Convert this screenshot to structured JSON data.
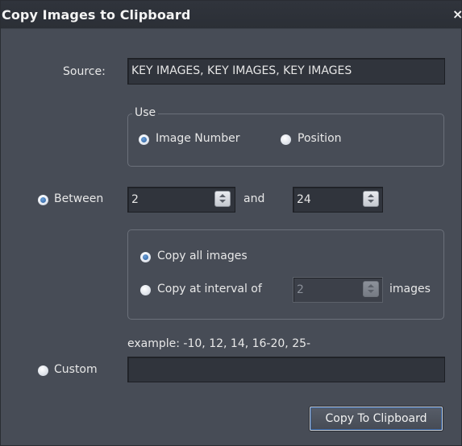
{
  "dialog": {
    "title": "Copy Images to Clipboard",
    "close_symbol": "×"
  },
  "source": {
    "label": "Source:",
    "value": "KEY IMAGES, KEY IMAGES, KEY IMAGES"
  },
  "use_group": {
    "legend": "Use",
    "options": [
      {
        "label": "Image Number",
        "selected": true
      },
      {
        "label": "Position",
        "selected": false
      }
    ]
  },
  "between": {
    "label": "Between",
    "selected": true,
    "from_value": "2",
    "and_label": "and",
    "to_value": "24"
  },
  "copy_group": {
    "options": [
      {
        "label": "Copy all images",
        "selected": true
      },
      {
        "label": "Copy at interval of",
        "selected": false
      }
    ],
    "interval_value": "2",
    "interval_suffix": "images"
  },
  "custom": {
    "example_text": "example: -10, 12, 14, 16-20, 25-",
    "label": "Custom",
    "selected": false,
    "value": ""
  },
  "actions": {
    "copy_button_label": "Copy To Clipboard"
  },
  "colors": {
    "accent": "#2c5f9e",
    "dialog_background": "#474c56",
    "field_background": "#30343c"
  },
  "icons": {
    "close": "close-icon",
    "spin": "spin-updown-icon"
  }
}
